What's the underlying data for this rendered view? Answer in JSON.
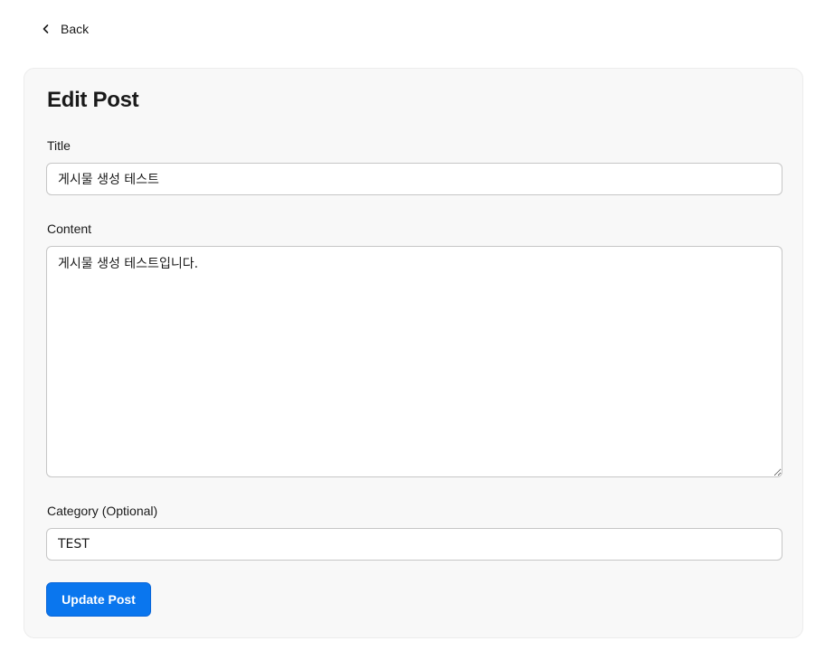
{
  "nav": {
    "back_label": "Back",
    "back_icon": "chevron-left-icon"
  },
  "form": {
    "heading": "Edit Post",
    "title_label": "Title",
    "title_value": "게시물 생성 테스트",
    "content_label": "Content",
    "content_value": "게시물 생성 테스트입니다.",
    "category_label": "Category (Optional)",
    "category_value": "TEST",
    "submit_label": "Update Post"
  },
  "colors": {
    "accent": "#0a76ee",
    "card_background": "#f8f8f8",
    "input_border": "#c6c6c6"
  }
}
